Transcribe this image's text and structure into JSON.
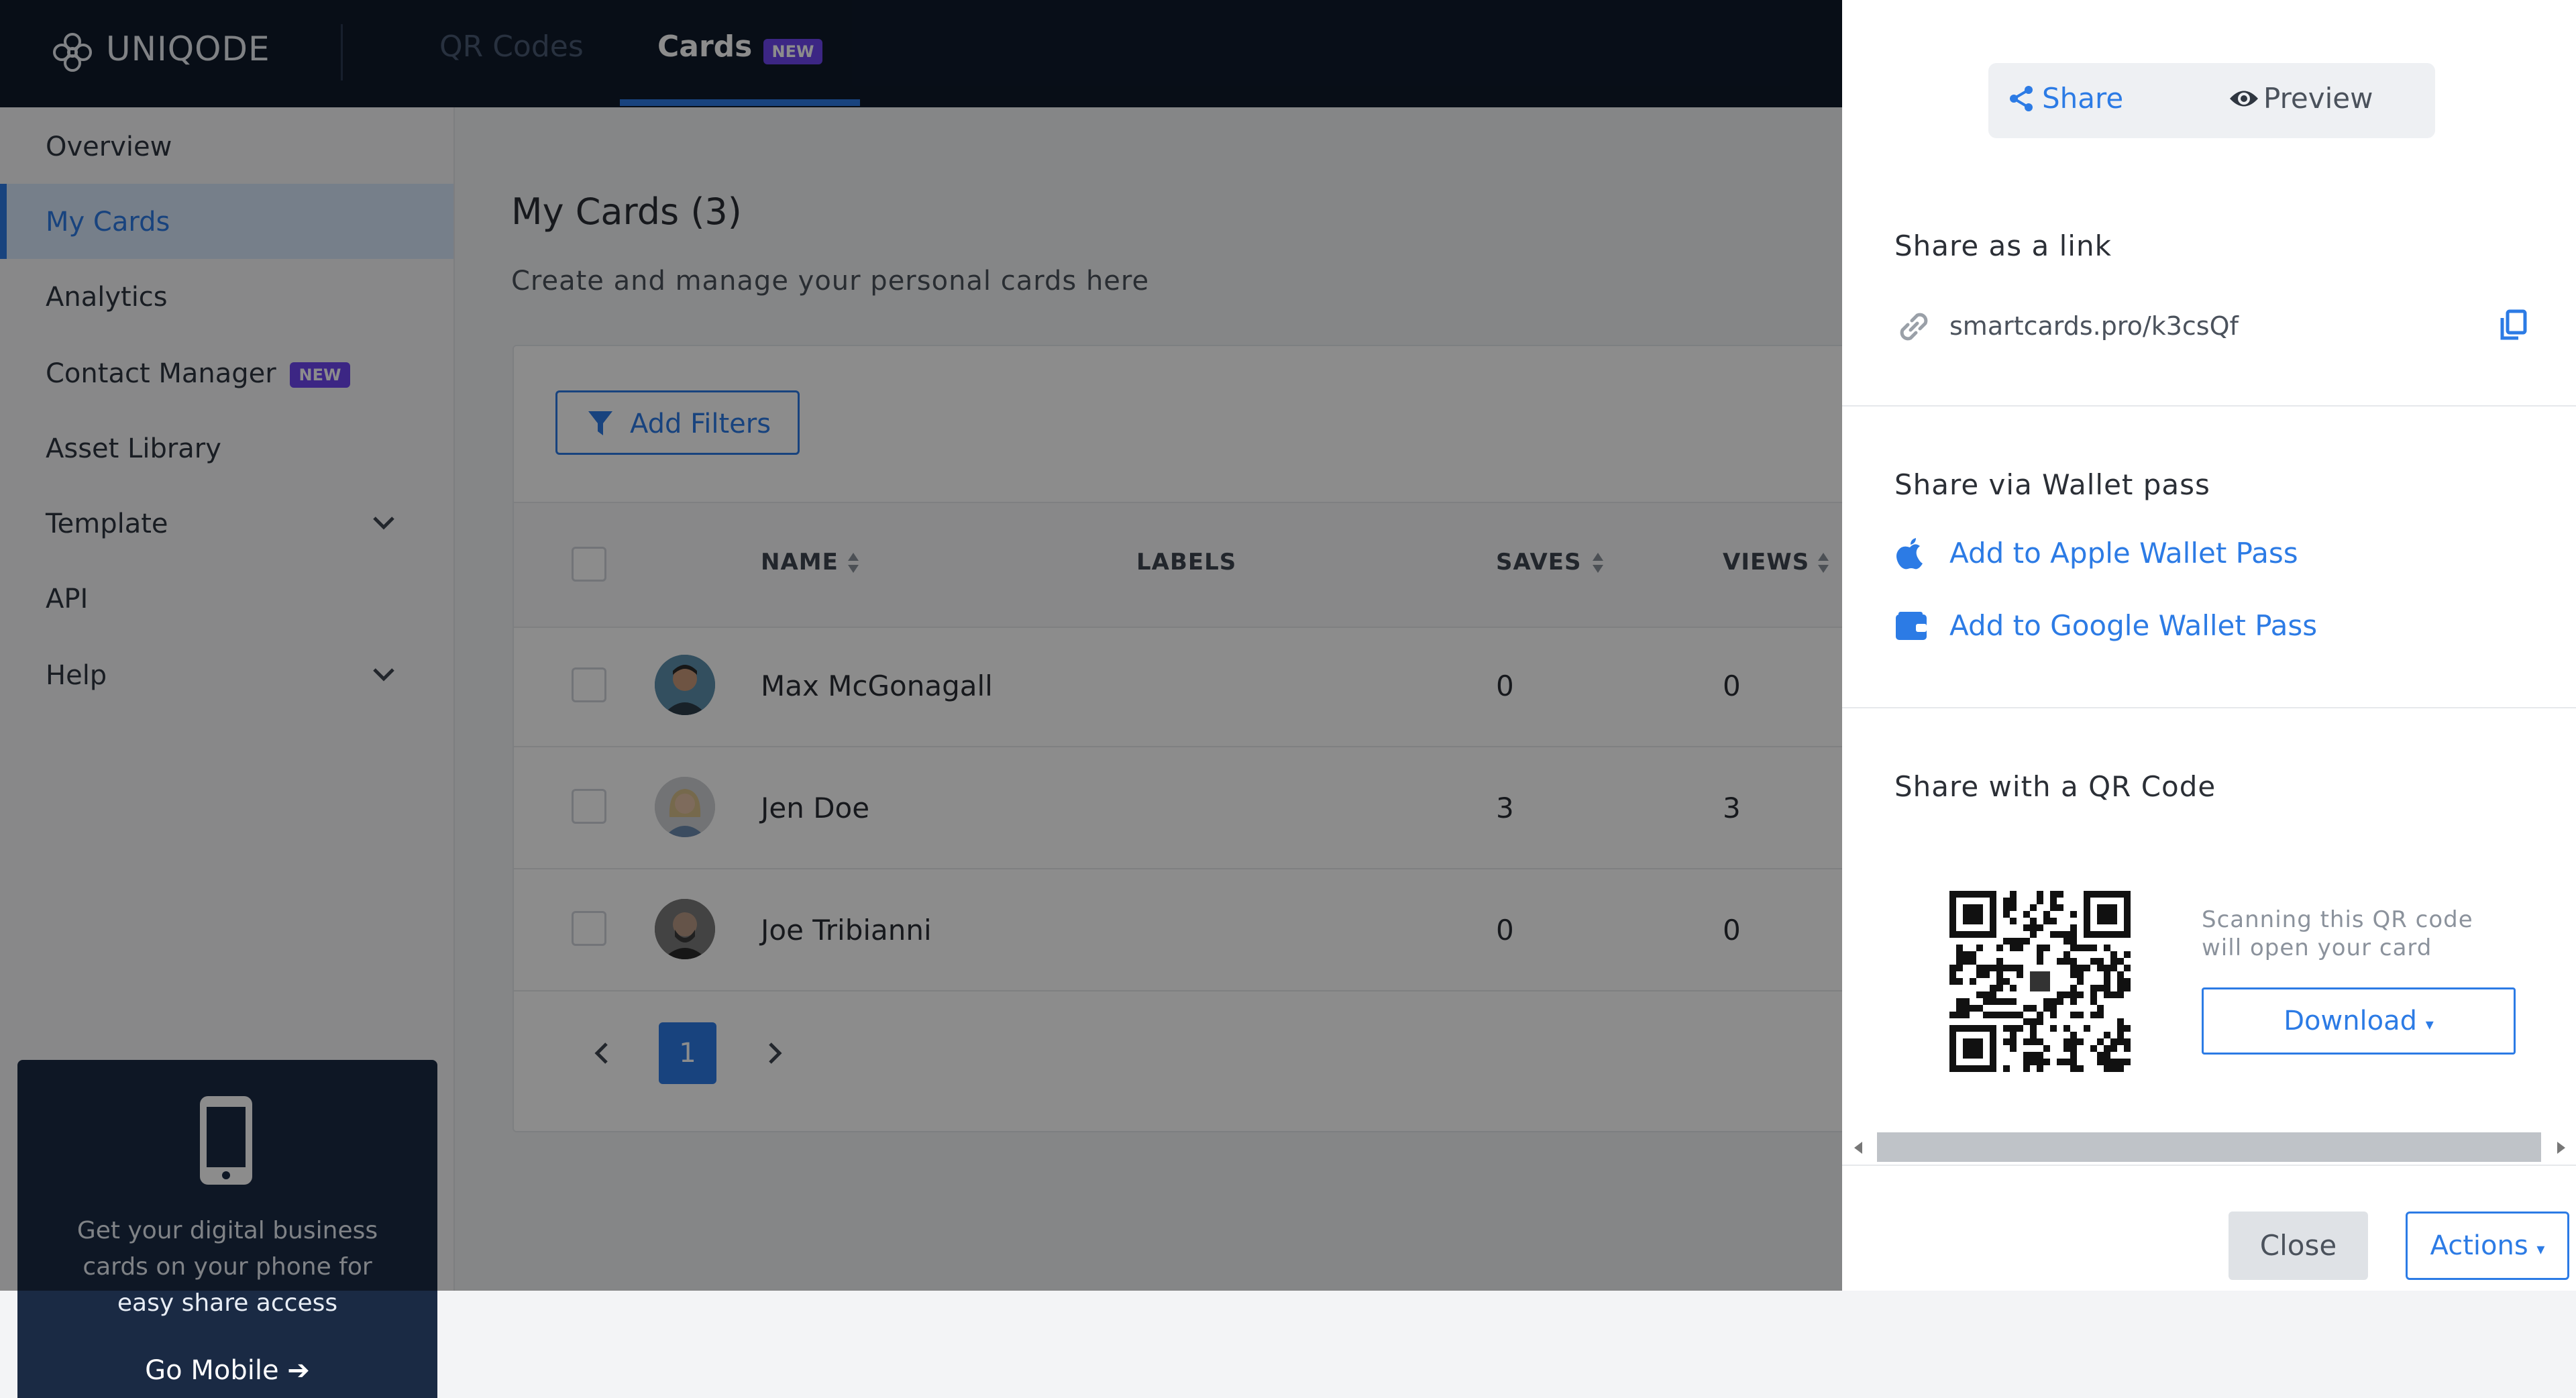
{
  "topbar": {
    "brand": "UNIQODE",
    "tabs": [
      {
        "label": "QR Codes"
      },
      {
        "label": "Cards",
        "badge": "NEW"
      }
    ]
  },
  "sidebar": {
    "items": [
      {
        "label": "Overview"
      },
      {
        "label": "My Cards",
        "active": true
      },
      {
        "label": "Analytics"
      },
      {
        "label": "Contact Manager",
        "badge": "NEW"
      },
      {
        "label": "Asset Library"
      },
      {
        "label": "Template"
      },
      {
        "label": "API"
      },
      {
        "label": "Help"
      }
    ],
    "promo": {
      "text": "Get your digital business cards on your phone for easy share access",
      "link": "Go Mobile"
    }
  },
  "main": {
    "title": "My Cards (3)",
    "subtitle": "Create and manage your personal cards here",
    "filter_button": "Add Filters",
    "table": {
      "headers": {
        "name": "NAME",
        "labels": "LABELS",
        "saves": "SAVES",
        "views": "VIEWS"
      },
      "rows": [
        {
          "name": "Max McGonagall",
          "saves": "0",
          "views": "0"
        },
        {
          "name": "Jen Doe",
          "saves": "3",
          "views": "3"
        },
        {
          "name": "Joe Tribianni",
          "saves": "0",
          "views": "0"
        }
      ]
    },
    "pagination": {
      "current": "1"
    }
  },
  "drawer": {
    "tabs": {
      "share": "Share",
      "preview": "Preview"
    },
    "share_link": {
      "title": "Share as a link",
      "url": "smartcards.pro/k3csQf"
    },
    "wallet": {
      "title": "Share via Wallet pass",
      "apple": "Add to Apple Wallet Pass",
      "google": "Add to Google Wallet Pass"
    },
    "qr": {
      "title": "Share with a QR Code",
      "note": "Scanning this QR code will open your card",
      "download": "Download"
    },
    "footer": {
      "close": "Close",
      "actions": "Actions"
    }
  },
  "colors": {
    "accent": "#2c7be5",
    "topbar": "#0f1a2b",
    "badge": "#6e45f0"
  }
}
